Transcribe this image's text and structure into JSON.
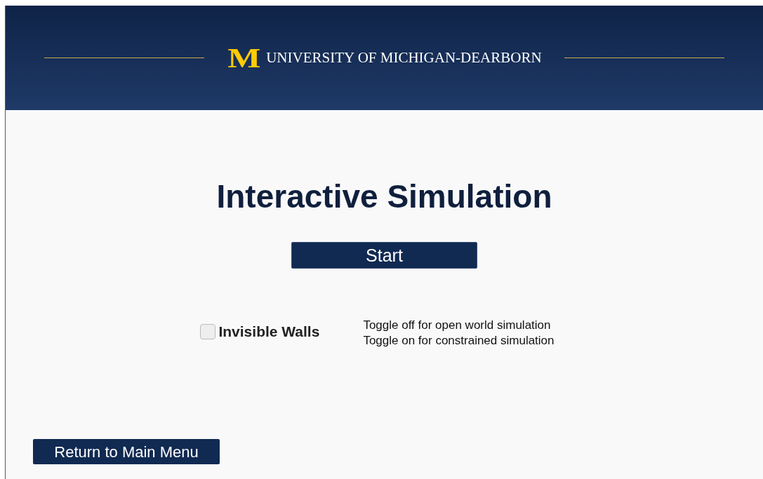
{
  "header": {
    "logo_letter": "M",
    "university": "UNIVERSITY OF MICHIGAN-DEARBORN"
  },
  "title": "Interactive Simulation",
  "start_button": "Start",
  "invisible_walls": {
    "label": "Invisible Walls",
    "checked": false,
    "notes": [
      "Toggle off for open world simulation",
      "Toggle on for constrained simulation"
    ]
  },
  "return_button": "Return to Main Menu"
}
